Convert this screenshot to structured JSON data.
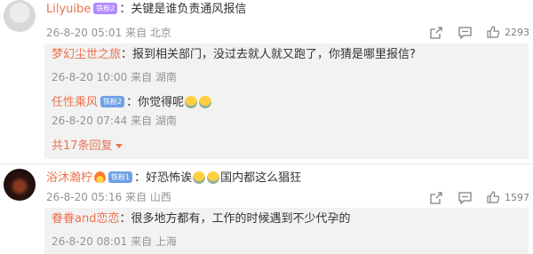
{
  "comments": [
    {
      "username": "Lilyuibe",
      "badge": "铁粉2",
      "text": "：关键是谁负责通风报信",
      "time": "26-8-20 05:01",
      "from": "来自",
      "location": "北京",
      "likes": "2293",
      "replies": [
        {
          "username": "梦幻尘世之旅",
          "text": "：报到相关部门，没过去就人就又跑了，你猜是哪里报信?",
          "time": "26-8-20 10:00",
          "from": "来自",
          "location": "湖南"
        },
        {
          "username": "任性乘风",
          "badge": "铁粉2",
          "text": "：你觉得呢",
          "time": "26-8-20 07:44",
          "from": "来自",
          "location": "湖南"
        }
      ],
      "more_replies": "共17条回复"
    },
    {
      "username": "浴沐瀚柠",
      "badge": "铁粉1",
      "text_before": "：好恐怖诶",
      "text_after": "国内都这么猖狂",
      "time": "26-8-20 05:16",
      "from": "来自",
      "location": "山西",
      "likes": "1597",
      "replies": [
        {
          "username": "眷眷and恋恋",
          "text": "：很多地方都有，工作的时候遇到不少代孕的",
          "time": "26-8-20 08:01",
          "from": "来自",
          "location": "上海"
        }
      ]
    }
  ],
  "colors": {
    "username": "#eb7350",
    "meta": "#939393",
    "reply_bg": "#f2f2f2"
  },
  "icons": [
    "share-icon",
    "comment-icon",
    "like-icon",
    "flame-icon",
    "crying-laughing-emoji",
    "crying-emoji"
  ]
}
